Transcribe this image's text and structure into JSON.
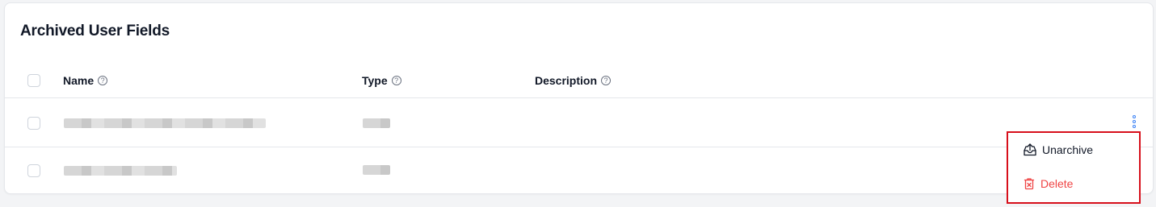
{
  "card": {
    "title": "Archived User Fields"
  },
  "table": {
    "columns": [
      {
        "label": "Name",
        "help_icon": "question-circle-icon"
      },
      {
        "label": "Type",
        "help_icon": "question-circle-icon"
      },
      {
        "label": "Description",
        "help_icon": "question-circle-icon"
      }
    ],
    "help_glyph": "?",
    "rows": [
      {
        "name": "",
        "type": "",
        "description": "",
        "name_obscured": true,
        "type_obscured": true
      },
      {
        "name": "",
        "type": "",
        "description": "",
        "name_obscured": true,
        "type_obscured": true
      }
    ]
  },
  "row_actions": {
    "trigger_icon": "vertical-ellipsis-icon",
    "menu": [
      {
        "label": "Unarchive",
        "icon": "unarchive-tray-icon"
      },
      {
        "label": "Delete",
        "icon": "trash-icon"
      }
    ]
  },
  "colors": {
    "accent": "#3b82f6",
    "danger": "#ef4444",
    "highlight_box": "#d70f1b"
  }
}
